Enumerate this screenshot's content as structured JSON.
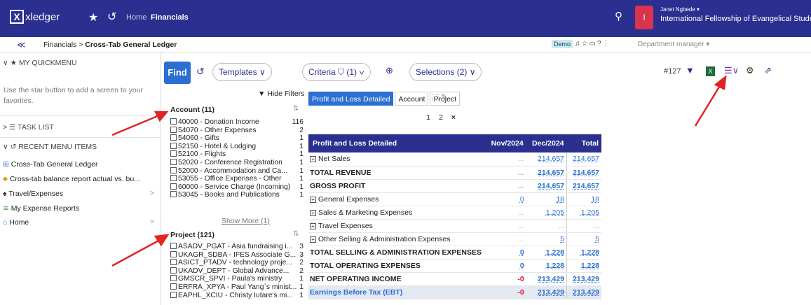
{
  "topbar": {
    "logo": "xledger",
    "home": "Home",
    "financials": "Financials",
    "user": "Janet Ngbede ▾",
    "org": "International Fellowship of Evangelical Stude",
    "avatar_letter": "I"
  },
  "subbar": {
    "crumb_parent": "Financials",
    "crumb_current": "Cross-Tab General Ledger",
    "demo": "Demo",
    "dept": "Department manager ▾"
  },
  "sidebar": {
    "quickmenu": "MY QUICKMENU",
    "quickmenu_note": "Use the star button to add a screen to your favorites.",
    "tasklist": "TASK LIST",
    "recent": "RECENT MENU ITEMS",
    "items": [
      {
        "label": "Cross-Tab General Ledger"
      },
      {
        "label": "Cross-tab balance report actual vs. bu..."
      },
      {
        "label": "Travel/Expenses"
      },
      {
        "label": "My Expense Reports"
      },
      {
        "label": "Home"
      }
    ]
  },
  "toolbar": {
    "find": "Find",
    "templates": "Templates ∨",
    "criteria": "Criteria ⛉ (1) ∨",
    "selections": "Selections (2) ∨",
    "report_no": "#127"
  },
  "filters": {
    "hide": "Hide Filters",
    "account_title": "Account (11)",
    "accounts": [
      {
        "label": "40000 - Donation Income",
        "count": "116"
      },
      {
        "label": "54070 - Other Expenses",
        "count": "2"
      },
      {
        "label": "54060 - Gifts",
        "count": "1"
      },
      {
        "label": "52150 - Hotel & Lodging",
        "count": "1"
      },
      {
        "label": "52100 - Flights",
        "count": "1"
      },
      {
        "label": "52020 - Conference Registration",
        "count": "1"
      },
      {
        "label": "52000 - Accommodation and Ca...",
        "count": "1"
      },
      {
        "label": "53055 - Office Expenses - Other",
        "count": "1"
      },
      {
        "label": "60000 - Service Charge (Incoming)",
        "count": "1"
      },
      {
        "label": "53045 - Books and Publications",
        "count": "1"
      }
    ],
    "show_more": "Show More (1)",
    "project_title": "Project (121)",
    "projects": [
      {
        "label": "ASADV_PGAT - Asia fundraising i...",
        "count": "3"
      },
      {
        "label": "UKAGR_SDBA - IFES Associate G...",
        "count": "3"
      },
      {
        "label": "ASICT_PTADV - technology proje...",
        "count": "2"
      },
      {
        "label": "UKADV_DEPT - Global Advance...",
        "count": "2"
      },
      {
        "label": "GMSCR_SPVI - Paula's ministry",
        "count": "1"
      },
      {
        "label": "ERFRA_XPYA - Paul Yang`s minist...",
        "count": "1"
      },
      {
        "label": "EAPHL_XCIU - Christy Iutare's mi...",
        "count": "1"
      }
    ]
  },
  "tabs": [
    {
      "label": "Profit and Loss Detailed"
    },
    {
      "label": "Account"
    },
    {
      "label": "Project"
    }
  ],
  "pager": {
    "p1": "1",
    "p2": "2",
    "close": "×"
  },
  "report": {
    "headers": [
      "Profit and Loss Detailed",
      "Nov/2024",
      "Dec/2024",
      "Total"
    ],
    "rows": [
      {
        "label": "Net Sales",
        "nov": "...",
        "dec": "214,657",
        "total": "214,657"
      },
      {
        "label": "TOTAL REVENUE",
        "nov": "...",
        "dec": "214,657",
        "total": "214,657"
      },
      {
        "label": "GROSS PROFIT",
        "nov": "...",
        "dec": "214,657",
        "total": "214,657"
      },
      {
        "label": "General Expenses",
        "nov": "0",
        "dec": "18",
        "total": "18"
      },
      {
        "label": "Sales & Marketing Expenses",
        "nov": "...",
        "dec": "1,205",
        "total": "1,205"
      },
      {
        "label": "Travel Expenses",
        "nov": "...",
        "dec": "...",
        "total": "..."
      },
      {
        "label": "Other Selling & Administration Expenses",
        "nov": "...",
        "dec": "5",
        "total": "5"
      },
      {
        "label": "TOTAL SELLING & ADMINISTRATION EXPENSES",
        "nov": "0",
        "dec": "1,228",
        "total": "1,228"
      },
      {
        "label": "TOTAL OPERATING EXPENSES",
        "nov": "0",
        "dec": "1,228",
        "total": "1,228"
      },
      {
        "label": "NET OPERATING INCOME",
        "nov": "-0",
        "dec": "213,429",
        "total": "213,429"
      },
      {
        "label": "Earnings Before Tax (EBT)",
        "nov": "-0",
        "dec": "213,429",
        "total": "213,429"
      }
    ]
  },
  "colors": {
    "brand": "#2b2f8f",
    "accent": "#2b6fd0",
    "arrow": "#e02424"
  }
}
